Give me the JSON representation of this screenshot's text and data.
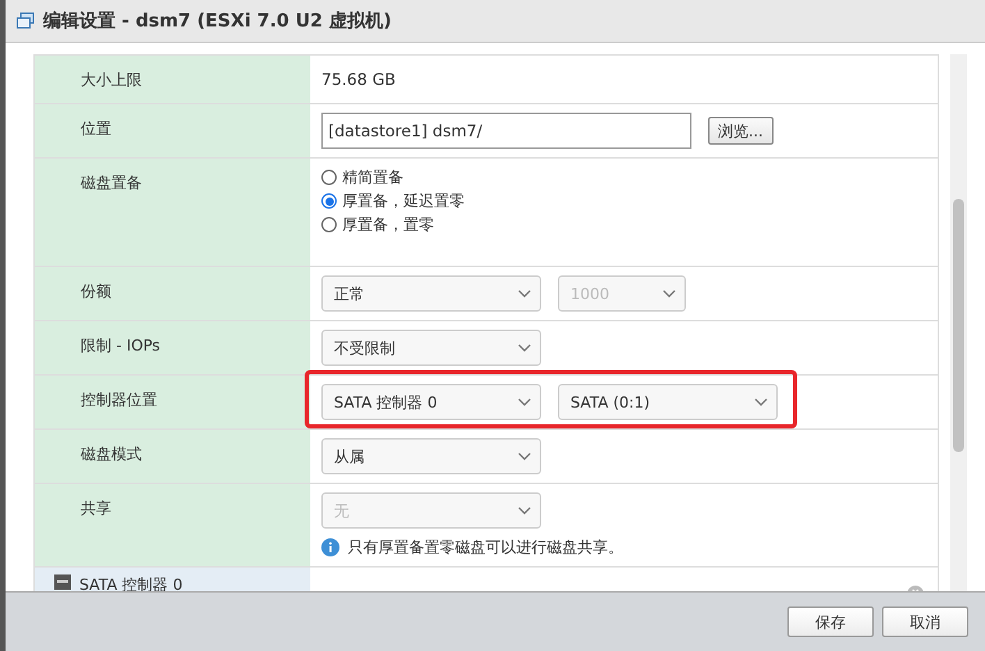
{
  "window": {
    "title": "编辑设置 - dsm7 (ESXi 7.0 U2 虚拟机)"
  },
  "rows": [
    {
      "kind": "text",
      "label": "大小上限",
      "value": "75.68 GB"
    },
    {
      "kind": "path",
      "label": "位置",
      "value": "[datastore1] dsm7/",
      "button": "浏览..."
    },
    {
      "kind": "radios",
      "label": "磁盘置备",
      "options": [
        {
          "label": "精简置备",
          "selected": false
        },
        {
          "label": "厚置备，延迟置零",
          "selected": true
        },
        {
          "label": "厚置备，置零",
          "selected": false
        }
      ]
    },
    {
      "kind": "selects",
      "label": "份额",
      "selects": [
        {
          "value": "正常",
          "disabled": false
        },
        {
          "value": "1000",
          "disabled": true
        }
      ]
    },
    {
      "kind": "selects",
      "label": "限制 - IOPs",
      "selects": [
        {
          "value": "不受限制",
          "disabled": false
        }
      ]
    },
    {
      "kind": "selects",
      "label": "控制器位置",
      "highlighted": true,
      "selects": [
        {
          "value": "SATA 控制器 0",
          "disabled": false
        },
        {
          "value": "SATA (0:1)",
          "disabled": false
        }
      ]
    },
    {
      "kind": "selects",
      "label": "磁盘模式",
      "selects": [
        {
          "value": "从属",
          "disabled": false
        }
      ]
    },
    {
      "kind": "selects",
      "label": "共享",
      "selects": [
        {
          "value": "无",
          "disabled": true
        }
      ],
      "note": "只有厚置备置零磁盘可以进行磁盘共享。"
    }
  ],
  "section": {
    "label": "SATA 控制器 0"
  },
  "buttons": [
    "保存",
    "取消"
  ]
}
